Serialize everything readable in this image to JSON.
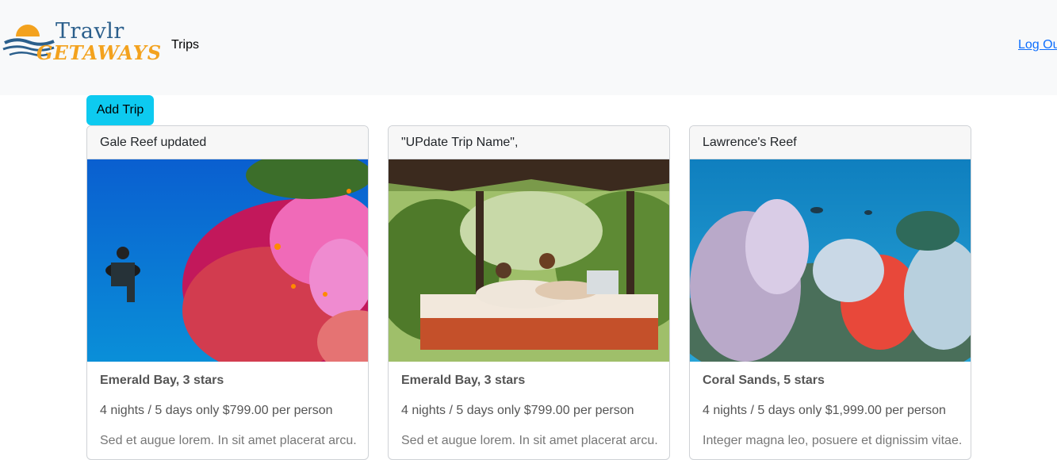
{
  "navbar": {
    "brand_name": "Travlr",
    "brand_subtitle": "GETAWAYS",
    "trips_link": "Trips",
    "logout_link": "Log Out"
  },
  "add_trip_button": "Add Trip",
  "trips": [
    {
      "name": "Gale Reef updated",
      "resort": "Emerald Bay, 3 stars",
      "price": "4 nights / 5 days only $799.00 per person",
      "description": "Sed et augue lorem. In sit amet placerat arcu."
    },
    {
      "name": "\"UPdate Trip Name\",",
      "resort": "Emerald Bay, 3 stars",
      "price": "4 nights / 5 days only $799.00 per person",
      "description": "Sed et augue lorem. In sit amet placerat arcu."
    },
    {
      "name": "Lawrence's Reef",
      "resort": "Coral Sands, 5 stars",
      "price": "4 nights / 5 days only $1,999.00 per person",
      "description": "Integer magna leo, posuere et dignissim vitae."
    }
  ]
}
